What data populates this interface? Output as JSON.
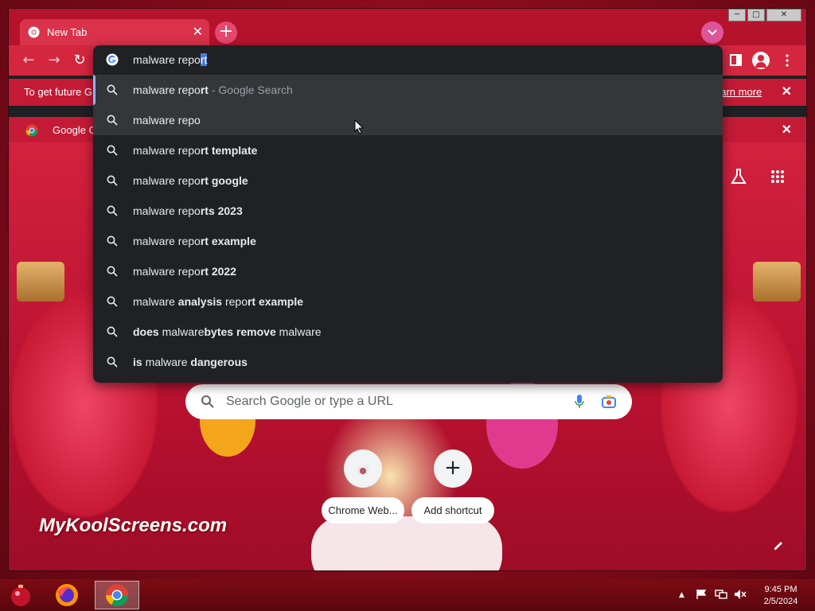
{
  "window": {
    "tab_title": "New Tab",
    "tab_close": "✕",
    "new_tab": "+",
    "minimize": "─",
    "maximize": "□",
    "close": "✕"
  },
  "toolbar": {
    "back": "←",
    "forward": "→",
    "reload": "↻"
  },
  "infobar_update": {
    "text": "To get future G",
    "learn_more": "earn more",
    "close": "✕"
  },
  "infobar_default": {
    "text": "Google C",
    "close": "✕"
  },
  "omnibox": {
    "typed_plain": "malware repo",
    "typed_selected": "rt",
    "suggestions": [
      {
        "parts": [
          {
            "t": "malware repo",
            "b": false
          },
          {
            "t": "rt",
            "b": true
          }
        ],
        "extra": " - Google Search"
      },
      {
        "parts": [
          {
            "t": "malware repo",
            "b": false
          }
        ],
        "extra": ""
      },
      {
        "parts": [
          {
            "t": "malware repo",
            "b": false
          },
          {
            "t": "rt template",
            "b": true
          }
        ],
        "extra": ""
      },
      {
        "parts": [
          {
            "t": "malware repo",
            "b": false
          },
          {
            "t": "rt google",
            "b": true
          }
        ],
        "extra": ""
      },
      {
        "parts": [
          {
            "t": "malware repo",
            "b": false
          },
          {
            "t": "rts 2023",
            "b": true
          }
        ],
        "extra": ""
      },
      {
        "parts": [
          {
            "t": "malware repo",
            "b": false
          },
          {
            "t": "rt example",
            "b": true
          }
        ],
        "extra": ""
      },
      {
        "parts": [
          {
            "t": "malware repo",
            "b": false
          },
          {
            "t": "rt 2022",
            "b": true
          }
        ],
        "extra": ""
      },
      {
        "parts": [
          {
            "t": "malware ",
            "b": false
          },
          {
            "t": "analysis ",
            "b": true
          },
          {
            "t": "repo",
            "b": false
          },
          {
            "t": "rt example",
            "b": true
          }
        ],
        "extra": ""
      },
      {
        "parts": [
          {
            "t": "does ",
            "b": true
          },
          {
            "t": "malware",
            "b": false
          },
          {
            "t": "bytes remove ",
            "b": true
          },
          {
            "t": "malware",
            "b": false
          }
        ],
        "extra": ""
      },
      {
        "parts": [
          {
            "t": "is ",
            "b": true
          },
          {
            "t": "malware ",
            "b": false
          },
          {
            "t": "dangerous",
            "b": true
          }
        ],
        "extra": ""
      }
    ]
  },
  "ntp": {
    "search_placeholder": "Search Google or type a URL",
    "shortcuts": [
      {
        "label": "Chrome Web...",
        "icon": "chrome-web-store-icon"
      },
      {
        "label": "Add shortcut",
        "icon": "plus-icon",
        "glyph": "+"
      }
    ],
    "watermark": "MyKoolScreens.com"
  },
  "taskbar": {
    "time": "9:45 PM",
    "date": "2/5/2024",
    "tray_arrow": "▲"
  },
  "colors": {
    "accent": "#d4263f",
    "omnibox_bg": "#202124",
    "selection": "#4d7bd6"
  }
}
